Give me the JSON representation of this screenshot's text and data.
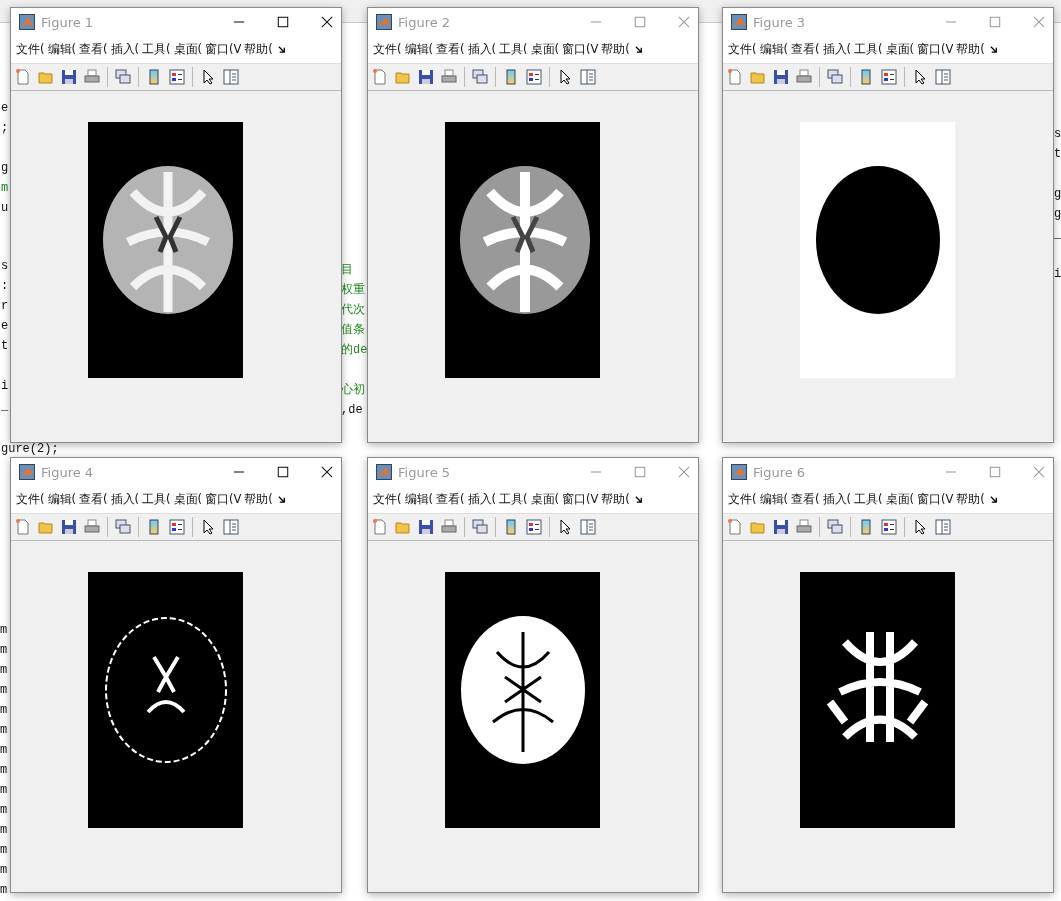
{
  "background_editor": {
    "left_blocks": [
      [
        {
          "text": "e",
          "kind": "code"
        },
        {
          "text": ";",
          "kind": "code"
        }
      ],
      [
        {
          "text": "g",
          "kind": "code"
        },
        {
          "text": "m",
          "kind": "comment"
        },
        {
          "text": "u",
          "kind": "code"
        }
      ],
      [
        {
          "text": "s",
          "kind": "code"
        },
        {
          "text": ":",
          "kind": "code"
        },
        {
          "text": "r",
          "kind": "code"
        },
        {
          "text": "e",
          "kind": "code"
        },
        {
          "text": "t",
          "kind": "code"
        }
      ],
      [
        {
          "text": "i",
          "kind": "code"
        },
        {
          "text": "_",
          "kind": "code"
        }
      ]
    ],
    "gap_line": "gure(2);",
    "output_lines": [
      "m",
      "m",
      "m",
      "m",
      "m",
      "m",
      "m",
      "m",
      "m",
      "m",
      "m",
      "m",
      "m",
      "m"
    ],
    "middle_lines": [
      {
        "text": "目",
        "kind": "comment"
      },
      {
        "text": "权重",
        "kind": "comment"
      },
      {
        "text": "代次",
        "kind": "comment"
      },
      {
        "text": "值条",
        "kind": "comment"
      },
      {
        "text": "的de",
        "kind": "comment"
      },
      {
        "text": "心初",
        "kind": "comment"
      },
      {
        "text": ",de",
        "kind": "code"
      }
    ],
    "right_lines": [
      "s",
      "t",
      "g",
      "g",
      "_",
      "i"
    ]
  },
  "figures": [
    {
      "title": "Figure 1",
      "active": true,
      "image": {
        "kind": "grayscale"
      },
      "menu": [
        "文件(",
        "编辑(",
        "查看(",
        "插入(",
        "工具(",
        "桌面(",
        "窗口(V",
        "帮助("
      ]
    },
    {
      "title": "Figure 2",
      "active": false,
      "image": {
        "kind": "gray-levels"
      },
      "menu": [
        "文件(",
        "编辑(",
        "查看(",
        "插入(",
        "工具(",
        "桌面(",
        "窗口(V",
        "帮助("
      ]
    },
    {
      "title": "Figure 3",
      "active": false,
      "image": {
        "kind": "inverted-mask"
      },
      "menu": [
        "文件(",
        "编辑(",
        "查看(",
        "插入(",
        "工具(",
        "桌面(",
        "窗口(V",
        "帮助("
      ]
    },
    {
      "title": "Figure 4",
      "active": true,
      "image": {
        "kind": "edge-mask"
      },
      "menu": [
        "文件(",
        "编辑(",
        "查看(",
        "插入(",
        "工具(",
        "桌面(",
        "窗口(V",
        "帮助("
      ]
    },
    {
      "title": "Figure 5",
      "active": false,
      "image": {
        "kind": "fill-mask"
      },
      "menu": [
        "文件(",
        "编辑(",
        "查看(",
        "插入(",
        "工具(",
        "桌面(",
        "窗口(V",
        "帮助("
      ]
    },
    {
      "title": "Figure 6",
      "active": false,
      "image": {
        "kind": "core-mask"
      },
      "menu": [
        "文件(",
        "编辑(",
        "查看(",
        "插入(",
        "工具(",
        "桌面(",
        "窗口(V",
        "帮助("
      ]
    }
  ]
}
